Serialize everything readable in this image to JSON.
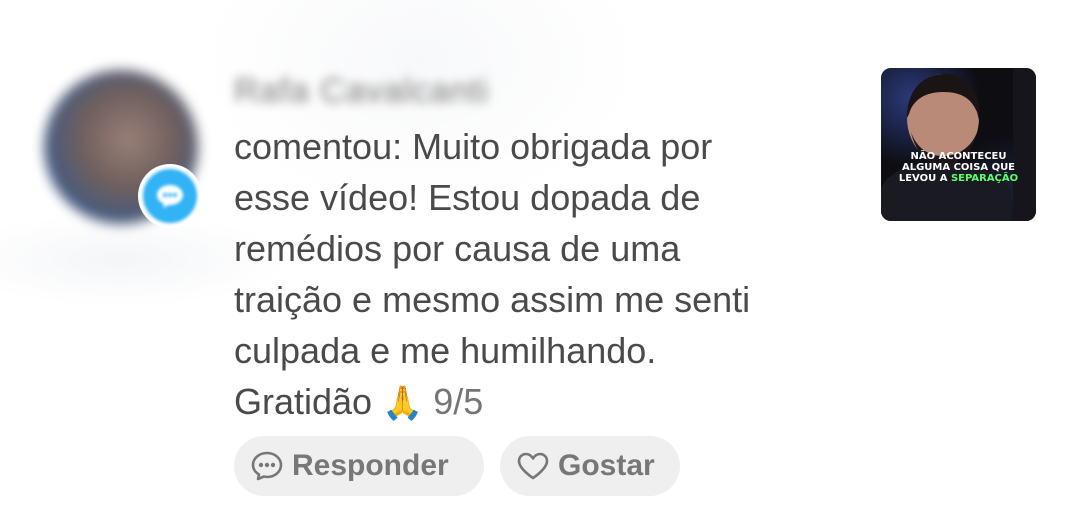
{
  "notification": {
    "author": "Rafa Cavalcanti",
    "comment_lines": [
      "comentou: Muito obrigada por",
      "esse vídeo! Estou dopada de",
      "remédios por causa de uma",
      "traição e mesmo assim me senti",
      "culpada e me humilhando."
    ],
    "last_line_text": "Gratidão",
    "emoji": "🙏",
    "date": "9/5",
    "badge_icon": "comment-bubble-icon",
    "colors": {
      "badge": "#31b3f5",
      "text": "#4a4a4a",
      "pill_bg": "#efefef",
      "highlight": "#5cff6a"
    }
  },
  "actions": {
    "reply_label": "Responder",
    "reply_icon": "speech-bubble-icon",
    "like_label": "Gostar",
    "like_icon": "heart-icon"
  },
  "thumbnail": {
    "caption_line1": "NÃO ACONTECEU",
    "caption_line2": "ALGUMA COISA QUE",
    "caption_line3_prefix": "LEVOU A ",
    "caption_highlight": "SEPARAÇÃO"
  }
}
